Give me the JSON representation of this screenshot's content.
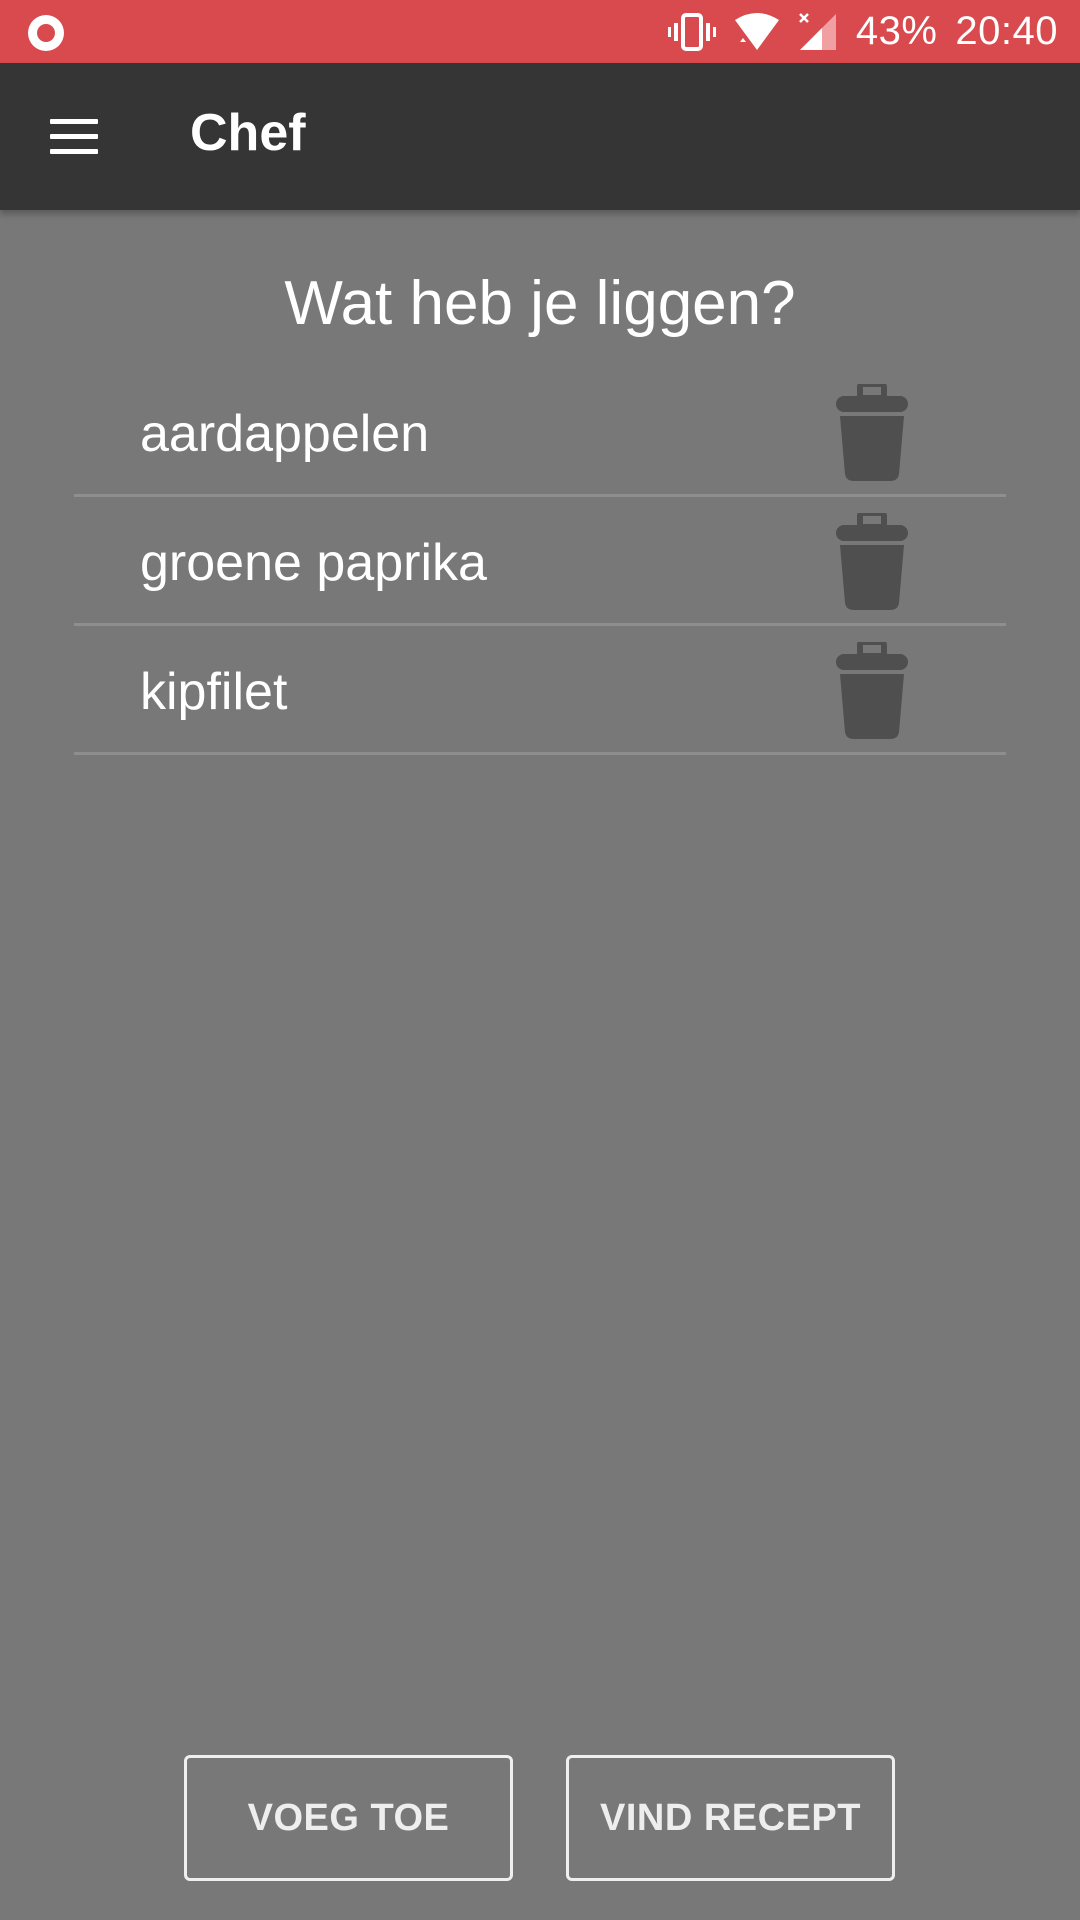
{
  "status_bar": {
    "battery": "43%",
    "time": "20:40",
    "icons": [
      "record-icon",
      "vibrate-icon",
      "wifi-icon",
      "signal-icon"
    ]
  },
  "app_bar": {
    "title": "Chef",
    "menu_icon": "hamburger-menu-icon"
  },
  "main": {
    "question": "Wat heb je liggen?",
    "items": [
      {
        "label": "aardappelen"
      },
      {
        "label": "groene paprika"
      },
      {
        "label": "kipfilet"
      }
    ],
    "delete_icon": "trash-icon"
  },
  "actions": {
    "add_label": "VOEG TOE",
    "find_label": "VIND RECEPT"
  },
  "colors": {
    "status_bar": "#d84a4e",
    "app_bar": "#353535",
    "background": "#787878",
    "trash": "#4f4f4f"
  }
}
